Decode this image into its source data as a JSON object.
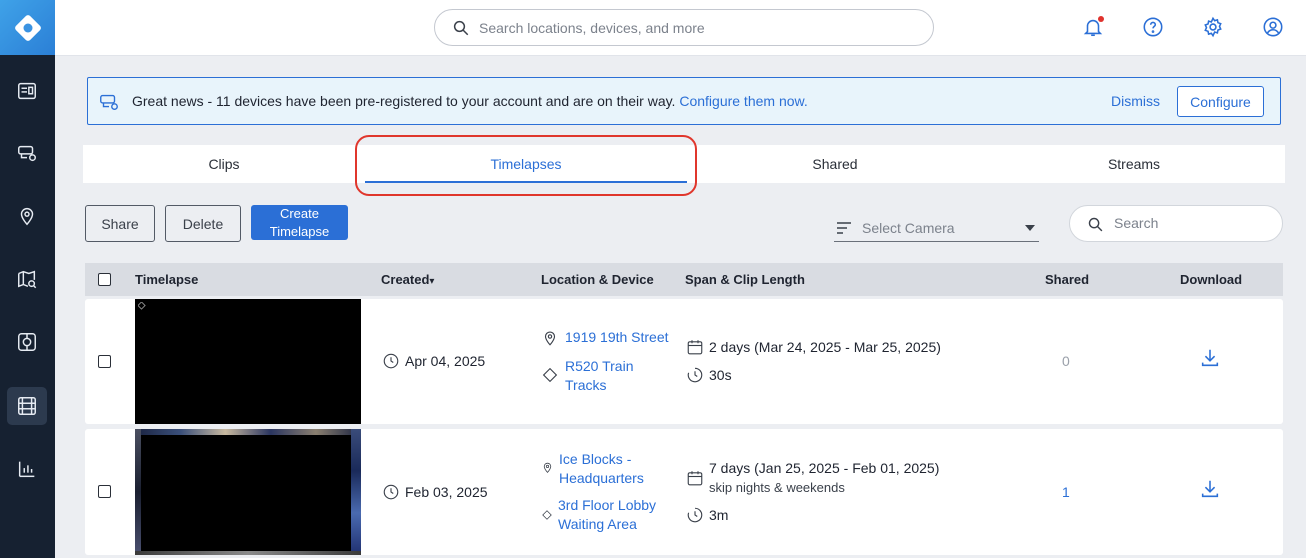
{
  "header": {
    "search_placeholder": "Search locations, devices, and more"
  },
  "banner": {
    "message": "Great news - 11 devices have been pre-registered to your account and are on their way.",
    "link": "Configure them now.",
    "dismiss": "Dismiss",
    "configure": "Configure"
  },
  "tabs": [
    "Clips",
    "Timelapses",
    "Shared",
    "Streams"
  ],
  "active_tab": "Timelapses",
  "toolbar": {
    "share": "Share",
    "delete": "Delete",
    "create_line1": "Create",
    "create_line2": "Timelapse",
    "select_camera": "Select Camera",
    "search_placeholder": "Search"
  },
  "table": {
    "headers": {
      "timelapse": "Timelapse",
      "created": "Created",
      "sort_marker": "▾",
      "location_device": "Location & Device",
      "span": "Span & Clip Length",
      "shared": "Shared",
      "download": "Download"
    },
    "rows": [
      {
        "created": "Apr 04, 2025",
        "location": "1919 19th Street",
        "device_line1": "R520 Train",
        "device_line2": "Tracks",
        "span": "2 days (Mar 24, 2025 - Mar 25, 2025)",
        "note": "",
        "clip_length": "30s",
        "shared": "0"
      },
      {
        "created": "Feb 03, 2025",
        "location_line1": "Ice Blocks -",
        "location_line2": "Headquarters",
        "device_line1": "3rd Floor Lobby",
        "device_line2": "Waiting Area",
        "span": "7 days (Jan 25, 2025 - Feb 01, 2025)",
        "note": "skip nights & weekends",
        "clip_length": "3m",
        "shared": "1"
      }
    ]
  },
  "colors": {
    "accent": "#2b6fd6",
    "sidebar": "#162131",
    "highlight": "#e0362c"
  }
}
